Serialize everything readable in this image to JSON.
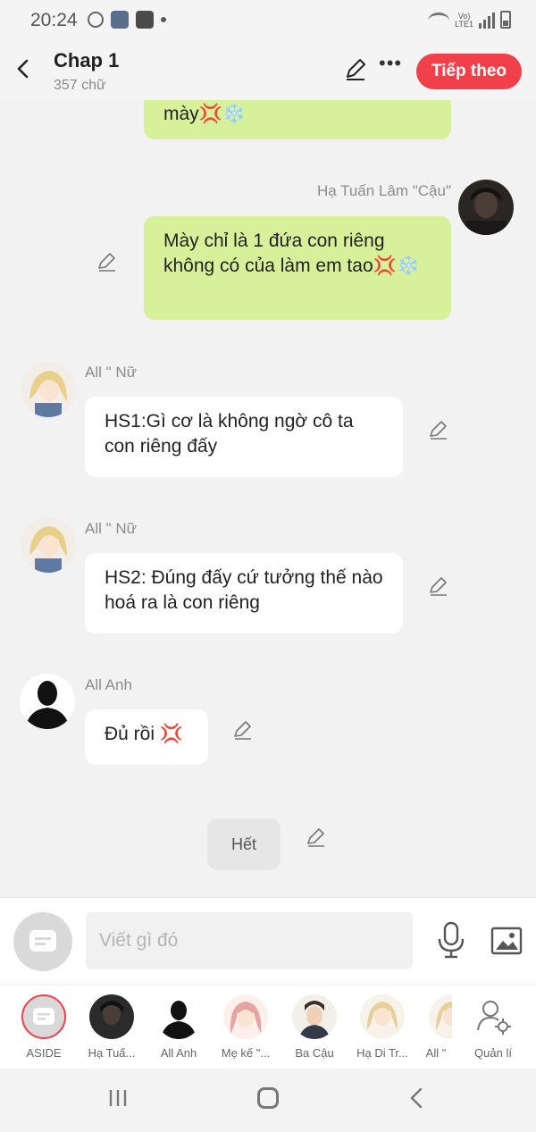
{
  "status_bar": {
    "time": "20:24",
    "network": "LTE1"
  },
  "header": {
    "title": "Chap 1",
    "word_count": "357 chữ",
    "next_label": "Tiếp theo"
  },
  "messages": [
    {
      "side": "right",
      "text": "mày💢❄️"
    },
    {
      "side": "right",
      "name": "Hạ Tuấn Lâm \"Cậu\"",
      "text": "Mày chỉ là 1 đứa con riêng không có của làm em tao💢❄️"
    },
    {
      "side": "left",
      "name": "All \" Nữ",
      "text": "HS1:Gì cơ là không ngờ cô ta con riêng đấy"
    },
    {
      "side": "left",
      "name": "All \" Nữ",
      "text": "HS2: Đúng đấy cứ tưởng thế nào hoá ra là con riêng"
    },
    {
      "side": "left",
      "name": "All Anh",
      "text": "Đủ rồi 💢"
    }
  ],
  "end_label": "Hết",
  "composer": {
    "placeholder": "Viết gì đó"
  },
  "characters": [
    {
      "label": "ASIDE",
      "icon": "aside-icon"
    },
    {
      "label": "Hạ Tuấ...",
      "color": "#2b2b2b"
    },
    {
      "label": "All Anh",
      "color": "#1e1e1e"
    },
    {
      "label": "Mẹ kế \"...",
      "color": "#e6a4a0"
    },
    {
      "label": "Ba Cậu",
      "color": "#6b5a4f"
    },
    {
      "label": "Hạ Di Tr...",
      "color": "#e8cf9a"
    },
    {
      "label": "All \"",
      "color": "#e8cf9a"
    },
    {
      "label": "Quản lí",
      "icon": "user-settings-icon"
    }
  ],
  "colors": {
    "accent": "#f2404b",
    "bubble_right": "#d7f19a",
    "bubble_left": "#ffffff"
  }
}
